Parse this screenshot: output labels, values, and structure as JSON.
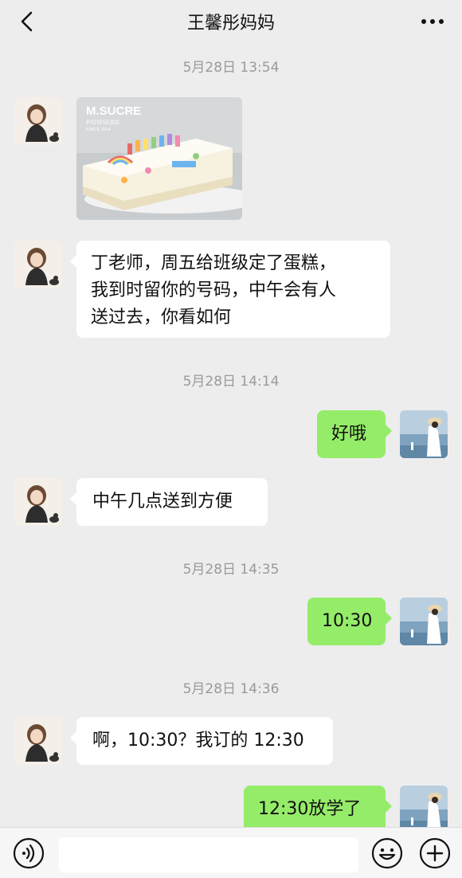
{
  "header": {
    "title": "王馨彤妈妈",
    "back_icon": "chevron-left-icon",
    "more_icon": "more-dots-icon"
  },
  "messages": [
    {
      "type": "time",
      "text": "5月28日 13:54"
    },
    {
      "type": "image",
      "side": "left",
      "caption": "M.SUCRE",
      "sub1": "PATISSERIE",
      "sub2": "SINCE 2014"
    },
    {
      "type": "text",
      "side": "left",
      "lines": [
        "丁老师，周五给班级定了蛋糕，",
        "我到时留你的号码，中午会有人",
        "送过去，你看如何"
      ]
    },
    {
      "type": "time",
      "text": "5月28日 14:14"
    },
    {
      "type": "text",
      "side": "right",
      "text": "好哦"
    },
    {
      "type": "text",
      "side": "left",
      "text": "中午几点送到方便"
    },
    {
      "type": "time",
      "text": "5月28日 14:35"
    },
    {
      "type": "text",
      "side": "right",
      "text": "10:30"
    },
    {
      "type": "time",
      "text": "5月28日 14:36"
    },
    {
      "type": "text",
      "side": "left",
      "text": "啊，10:30？我订的 12:30"
    },
    {
      "type": "text",
      "side": "right",
      "text": "12:30放学了"
    }
  ],
  "bottom": {
    "voice_icon": "voice-icon",
    "emoji_icon": "emoji-icon",
    "add_icon": "plus-circle-icon"
  },
  "colors": {
    "background": "#ededed",
    "self_bubble": "#95ec69",
    "other_bubble": "#ffffff",
    "timestamp": "#9a9a9a"
  }
}
